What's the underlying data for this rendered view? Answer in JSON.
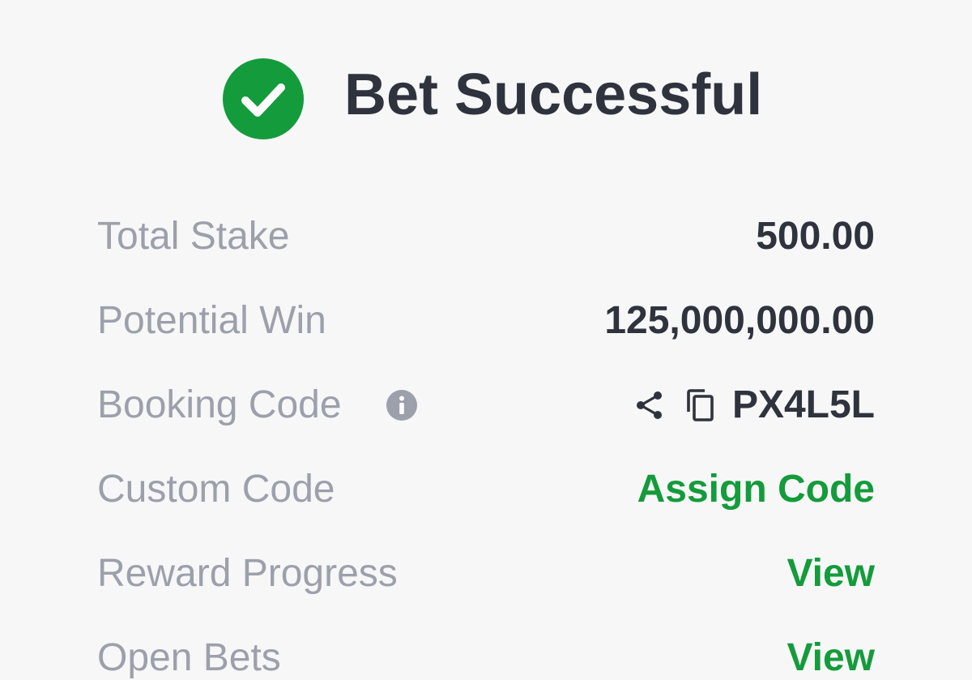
{
  "header": {
    "title": "Bet Successful",
    "status_icon": "check-circle-icon",
    "accent_color": "#149b3b"
  },
  "summary": {
    "total_stake": {
      "label": "Total Stake",
      "value": "500.00"
    },
    "potential_win": {
      "label": "Potential Win",
      "value": "125,000,000.00"
    },
    "booking_code": {
      "label": "Booking Code",
      "info_icon": "info-icon",
      "share_icon": "share-icon",
      "copy_icon": "copy-icon",
      "code": "PX4L5L"
    },
    "custom_code": {
      "label": "Custom Code",
      "action": "Assign Code"
    },
    "reward_progress": {
      "label": "Reward Progress",
      "action": "View"
    },
    "open_bets": {
      "label": "Open Bets",
      "action": "View"
    }
  },
  "colors": {
    "text_primary": "#2e333d",
    "text_secondary": "#9ca0ab",
    "background": "#f7f7f8",
    "link": "#149b3b"
  }
}
